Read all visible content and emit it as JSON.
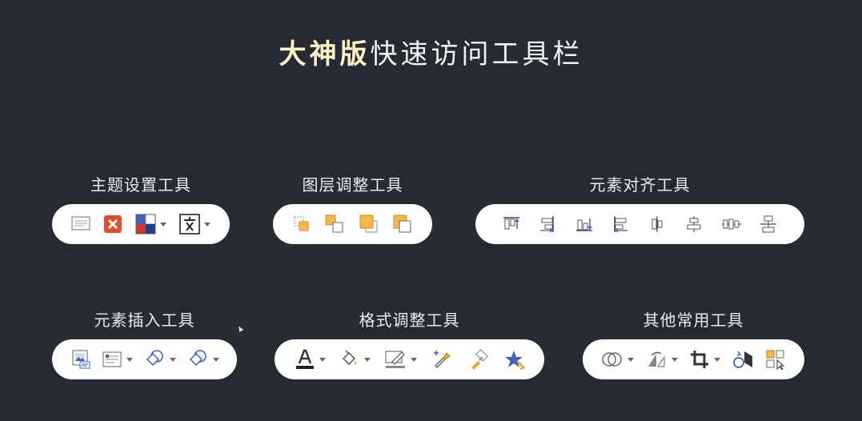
{
  "title": {
    "bold": "大神版",
    "rest": "快速访问工具栏"
  },
  "groups": [
    {
      "label": "主题设置工具"
    },
    {
      "label": "图层调整工具"
    },
    {
      "label": "元素对齐工具"
    },
    {
      "label": "元素插入工具"
    },
    {
      "label": "格式调整工具"
    },
    {
      "label": "其他常用工具"
    }
  ],
  "colors": {
    "accent_orange": "#f0a830",
    "accent_blue": "#3a63b8",
    "red": "#e04e2e",
    "bg": "#262a35"
  },
  "icons": {
    "theme": [
      "slide-layout-icon",
      "close-red-icon",
      "theme-colors-icon",
      "text-language-icon"
    ],
    "layer": [
      "bring-forward-icon",
      "send-backward-icon",
      "bring-to-front-icon",
      "send-to-back-icon"
    ],
    "align": [
      "align-top-icon",
      "align-right-icon",
      "align-bottom-icon",
      "align-left-icon",
      "distribute-center-icon",
      "align-center-icon",
      "distribute-horizontal-icon",
      "align-middle-icon"
    ],
    "insert": [
      "insert-picture-icon",
      "insert-textbox-icon",
      "shape-union-icon",
      "shape-combine-icon"
    ],
    "format": [
      "font-color-icon",
      "fill-color-icon",
      "outline-color-icon",
      "eyedropper-icon",
      "format-painter-icon",
      "effects-star-icon"
    ],
    "other": [
      "merge-shapes-icon",
      "rotate-icon",
      "crop-icon",
      "flip-icon",
      "selection-pane-icon"
    ]
  }
}
